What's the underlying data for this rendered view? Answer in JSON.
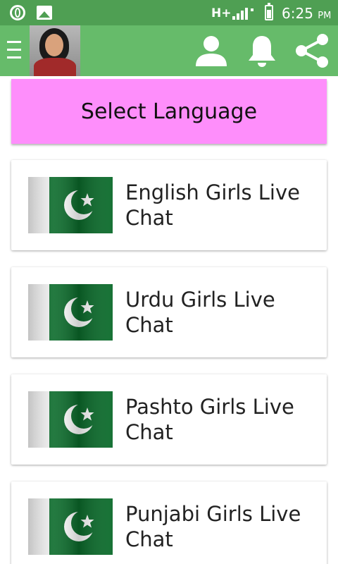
{
  "status_bar": {
    "network": "H+",
    "time": "6:25",
    "ampm": "PM",
    "icons": [
      "opera-icon",
      "gallery-icon",
      "signal-icon",
      "battery-icon"
    ]
  },
  "app_bar": {
    "icons": [
      "menu-icon",
      "avatar",
      "profile-icon",
      "bell-icon",
      "share-icon"
    ],
    "color": "#66bb6a"
  },
  "header": {
    "label": "Select Language",
    "color": "#fe8efb"
  },
  "languages": [
    {
      "label": "English Girls Live Chat",
      "icon": "pakistan-flag-icon"
    },
    {
      "label": "Urdu Girls Live Chat",
      "icon": "pakistan-flag-icon"
    },
    {
      "label": "Pashto Girls Live Chat",
      "icon": "pakistan-flag-icon"
    },
    {
      "label": "Punjabi Girls Live Chat",
      "icon": "pakistan-flag-icon"
    }
  ],
  "colors": {
    "status_bar": "#4f9f53",
    "flag_green": "#0b6b2b"
  }
}
